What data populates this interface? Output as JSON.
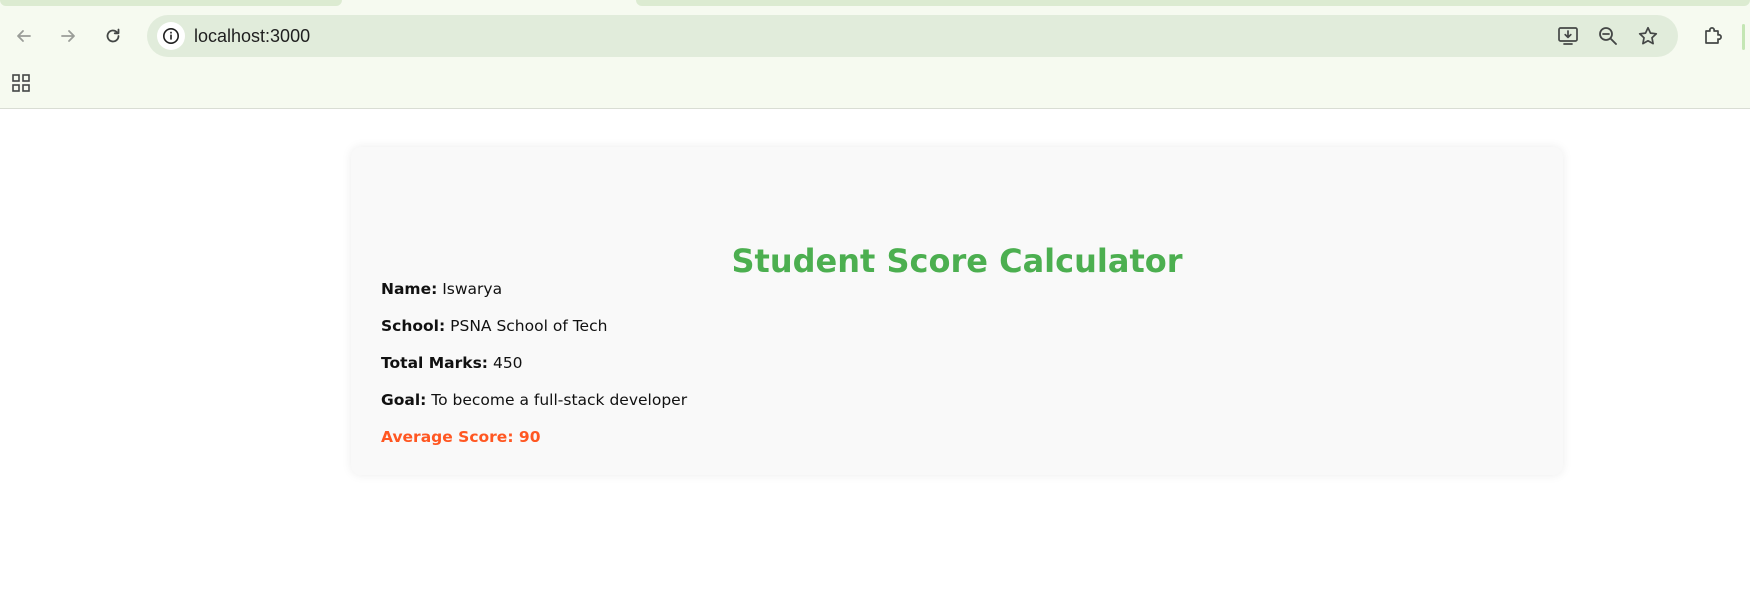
{
  "browser": {
    "url": "localhost:3000",
    "icons": {
      "back": "back-arrow-icon",
      "forward": "forward-arrow-icon",
      "reload": "reload-icon",
      "site_info": "info-icon",
      "install": "install-app-icon",
      "zoom": "zoom-out-icon",
      "bookmark": "star-icon",
      "extensions": "puzzle-icon",
      "apps": "apps-grid-icon"
    }
  },
  "page": {
    "title": "Student Score Calculator",
    "fields": {
      "name": {
        "label": "Name:",
        "value": "Iswarya"
      },
      "school": {
        "label": "School:",
        "value": "PSNA School of Tech"
      },
      "total_marks": {
        "label": "Total Marks:",
        "value": "450"
      },
      "goal": {
        "label": "Goal:",
        "value": "To become a full-stack developer"
      }
    },
    "average": "Average Score: 90"
  },
  "colors": {
    "title": "#4caf50",
    "average": "#ff5722",
    "card_background": "#f9f9f9",
    "chrome_background": "#f6faf0",
    "omnibox_background": "#e1ecdb"
  }
}
